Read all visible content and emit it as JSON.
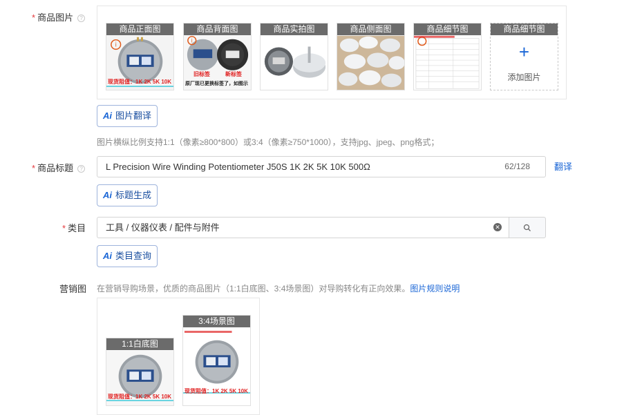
{
  "product_images": {
    "label": "商品图片",
    "thumbs": [
      {
        "caption": "商品正面图",
        "overlay": "现货阻值：1K 2K 5K 10K"
      },
      {
        "caption": "商品背面图",
        "overlay": "原厂现已更换标签了，如图示",
        "tag_old": "旧标签",
        "tag_new": "新标签"
      },
      {
        "caption": "商品实拍图"
      },
      {
        "caption": "商品侧面图"
      },
      {
        "caption": "商品细节图"
      }
    ],
    "add_caption": "商品细节图",
    "add_label": "添加图片",
    "ai_button": "图片翻译",
    "hint": "图片横纵比例支持1:1（像素≥800*800）或3:4（像素≥750*1000），支持jpg、jpeg、png格式；"
  },
  "product_title": {
    "label": "商品标题",
    "value": "L Precision Wire Winding Potentiometer J50S 1K 2K 5K 10K 500Ω",
    "counter": "62/128",
    "translate": "翻译",
    "ai_button": "标题生成"
  },
  "category": {
    "label": "类目",
    "value": "工具 / 仪器仪表 / 配件与附件",
    "ai_button": "类目查询"
  },
  "marketing": {
    "label": "营销图",
    "hint": "在营销导购场景，优质的商品图片（1:1白底图、3:4场景图）对导购转化有正向效果。",
    "hint_link": "图片规则说明",
    "square_caption": "1:1白底图",
    "portrait_caption": "3:4场景图",
    "overlay": "现货阻值：1K 2K 5K 10K"
  },
  "ai_mark": "Ai",
  "colors": {
    "accent": "#1a66d6",
    "required": "#e4393c",
    "caption_bg": "#6b6b6b",
    "overlay_text": "#e02020"
  },
  "icons": [
    "question-circle-icon",
    "plus-icon",
    "clear-icon",
    "search-icon",
    "ai-icon",
    "info-icon"
  ]
}
